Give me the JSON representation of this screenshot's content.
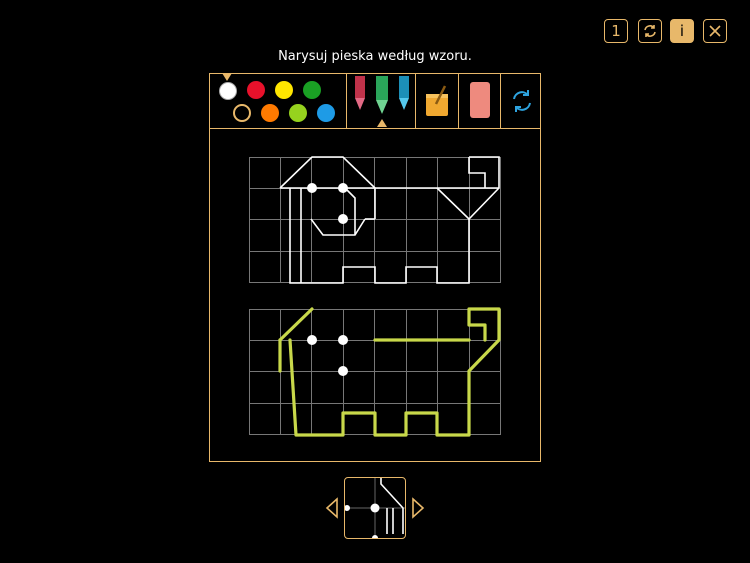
{
  "header": {
    "buttons": [
      {
        "name": "page-number-button",
        "label": "1",
        "icon": "number-icon"
      },
      {
        "name": "reload-button",
        "label": "",
        "icon": "reload-icon"
      },
      {
        "name": "info-button",
        "label": "i",
        "icon": "info-icon"
      },
      {
        "name": "close-button",
        "label": "",
        "icon": "close-icon"
      }
    ]
  },
  "instruction": "Narysuj pieska według wzoru.",
  "toolbar": {
    "colors": [
      "#ffffff",
      "#e8112b",
      "#ffe600",
      "#1aa024",
      "transparent",
      "#ff7a00",
      "#96d21e",
      "#1e9be6"
    ],
    "selected_color_index": 0,
    "tools": [
      "pencil-red-icon",
      "pencil-green-icon",
      "pencil-blue-icon",
      "paint-bucket-icon",
      "eraser-icon",
      "refresh-icon"
    ],
    "selected_tool": "pencil-green-icon"
  },
  "colors": {
    "accent": "#e8b86a",
    "grid": "#777777",
    "pattern": "#ffffff",
    "drawing": "#c8d84a"
  }
}
